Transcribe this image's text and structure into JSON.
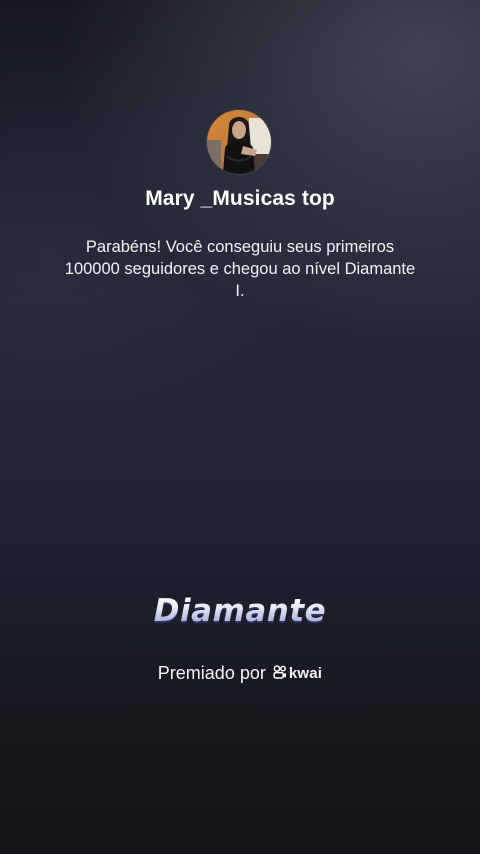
{
  "profile": {
    "username": "Mary _Musicas top",
    "avatar_icon": "profile-photo"
  },
  "message": "Parabéns! Você conseguiu seus primeiros 100000 seguidores e chegou ao nível Diamante I.",
  "level": {
    "name": "Diamante"
  },
  "award": {
    "label": "Premiado por",
    "brand": "kwai",
    "brand_icon": "kwai-logo-icon"
  },
  "colors": {
    "background_top": "#17181f",
    "background_mid": "#232636",
    "background_bottom": "#121316",
    "text": "#ffffff",
    "level_gradient_end": "#9aa2d2"
  }
}
